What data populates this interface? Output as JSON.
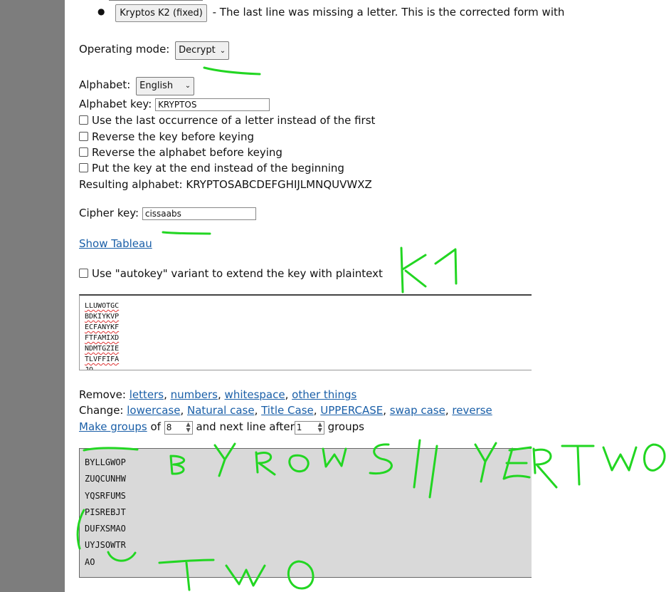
{
  "example_list": {
    "button_label": "Kryptos K2 (fixed)",
    "description": "- The last line was missing a letter. This is the corrected form with"
  },
  "operating_mode": {
    "label": "Operating mode:",
    "value": "Decrypt"
  },
  "alphabet": {
    "label": "Alphabet:",
    "value": "English"
  },
  "alphabet_key": {
    "label": "Alphabet key:",
    "value": "KRYPTOS"
  },
  "options": [
    {
      "label": "Use the last occurrence of a letter instead of the first",
      "checked": false
    },
    {
      "label": "Reverse the key before keying",
      "checked": false
    },
    {
      "label": "Reverse the alphabet before keying",
      "checked": false
    },
    {
      "label": "Put the key at the end instead of the beginning",
      "checked": false
    }
  ],
  "resulting_alphabet": {
    "label": "Resulting alphabet:",
    "value": "KRYPTOSABCDEFGHIJLMNQUVWXZ"
  },
  "cipher_key": {
    "label": "Cipher key:",
    "value": "cissaabs"
  },
  "show_tableau": "Show Tableau",
  "autokey": {
    "label": "Use \"autokey\" variant to extend the key with plaintext",
    "checked": false
  },
  "input_text": {
    "lines": [
      "LLUWOTGC",
      "BDKIYKVP",
      "ECFANYKF",
      "FTFAMIXD",
      "NDMTGZIE",
      "TLVFFIFA",
      "JO"
    ]
  },
  "remove": {
    "label": "Remove:",
    "links": [
      "letters",
      "numbers",
      "whitespace",
      "other things"
    ]
  },
  "change": {
    "label": "Change:",
    "links": [
      "lowercase",
      "Natural case",
      "Title Case",
      "UPPERCASE",
      "swap case",
      "reverse"
    ]
  },
  "groups": {
    "link": "Make groups",
    "of": "of",
    "group_size": "8",
    "next_line_text": "and next line after",
    "line_after": "1",
    "suffix": "groups"
  },
  "output_text": {
    "lines": [
      "BYLLGWOP",
      "ZUQCUNHW",
      "YQSRFUMS",
      "PISREBJT",
      "DUFXSMAO",
      "UYJSOWTR",
      "AO"
    ]
  },
  "colors": {
    "annotation": "#22d622",
    "link": "#1a5fa8",
    "output_bg": "#d9d9d9",
    "gutter": "#7d7d7d"
  }
}
